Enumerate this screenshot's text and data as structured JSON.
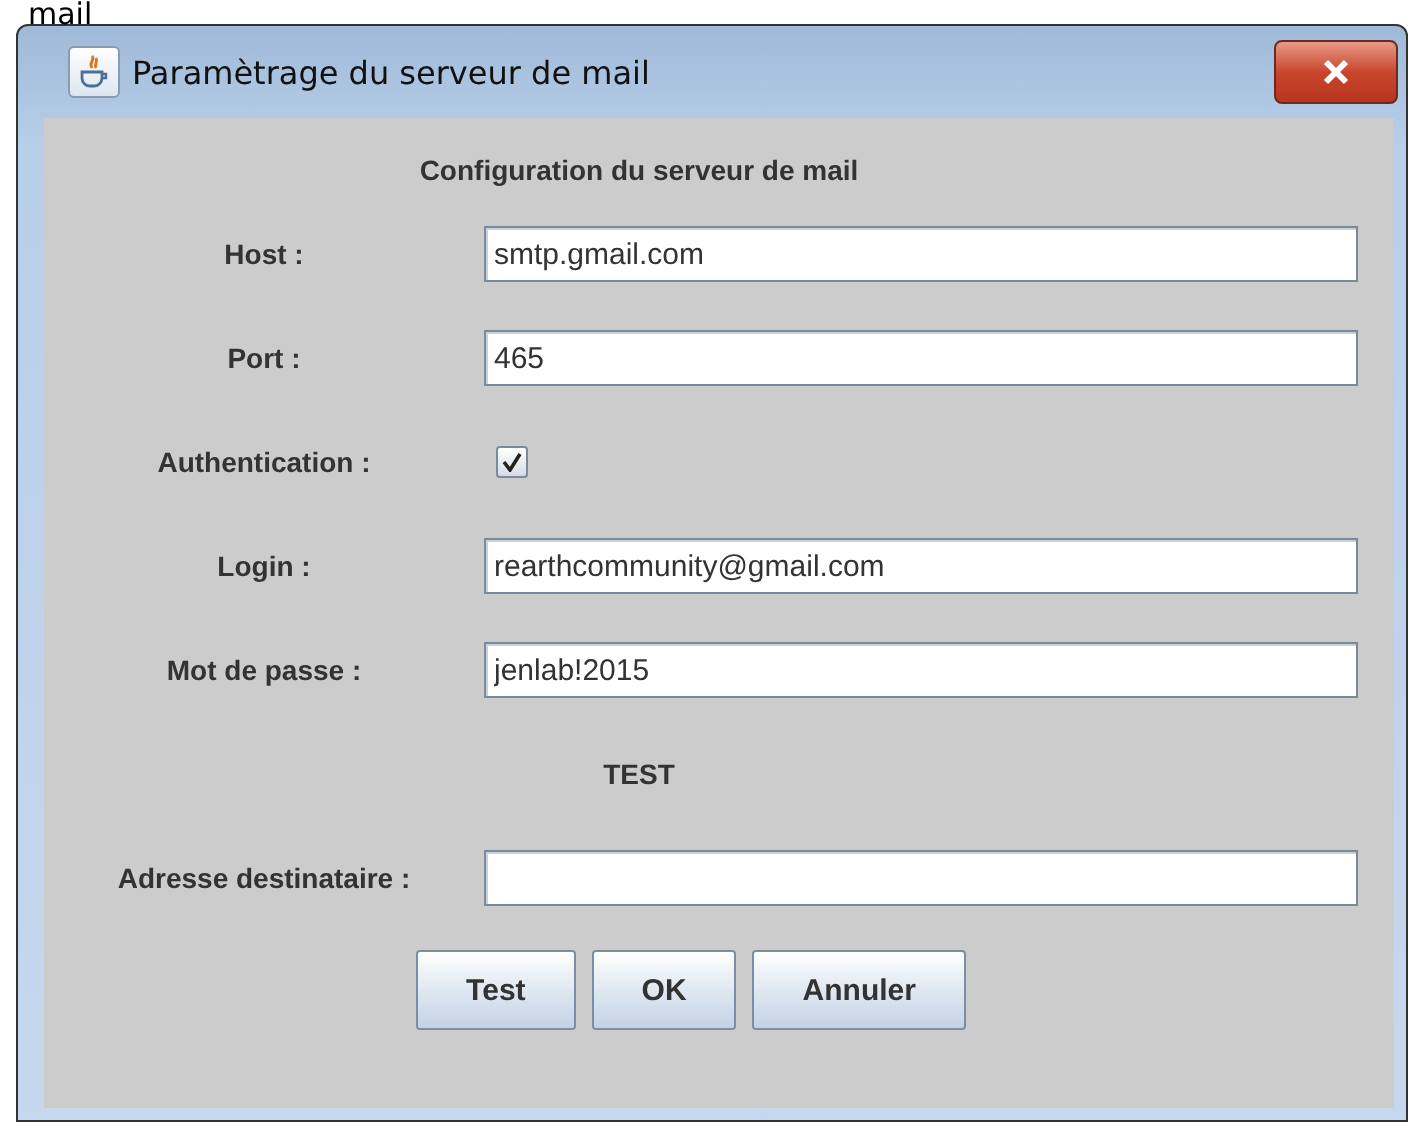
{
  "caption": "mail",
  "window": {
    "title": "Paramètrage du serveur de mail"
  },
  "form": {
    "heading": "Configuration du serveur de mail",
    "rows": [
      {
        "kind": "text",
        "label": "Host :",
        "value": "smtp.gmail.com"
      },
      {
        "kind": "text",
        "label": "Port :",
        "value": "465"
      },
      {
        "kind": "checkbox",
        "label": "Authentication :",
        "checked": true
      },
      {
        "kind": "text",
        "label": "Login :",
        "value": "rearthcommunity@gmail.com"
      },
      {
        "kind": "text",
        "label": "Mot de passe :",
        "value": "jenlab!2015"
      },
      {
        "kind": "heading",
        "label": "TEST"
      },
      {
        "kind": "text",
        "label": "Adresse destinataire :"
      }
    ]
  },
  "buttons": [
    "Test",
    "OK",
    "Annuler"
  ]
}
